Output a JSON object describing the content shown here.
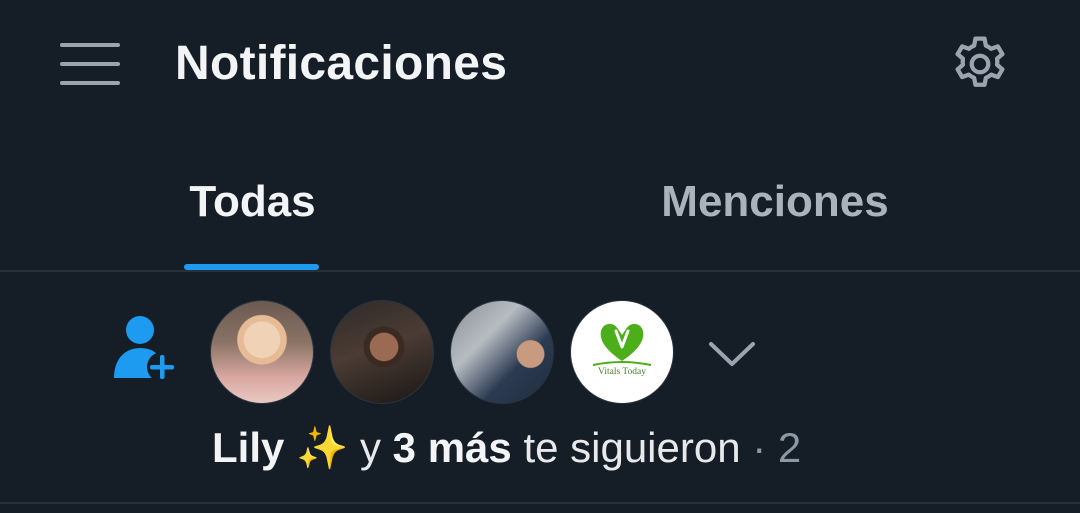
{
  "header": {
    "title": "Notificaciones",
    "menu_icon": "hamburger-menu-icon",
    "settings_icon": "gear-icon"
  },
  "tabs": [
    {
      "label": "Todas",
      "active": true
    },
    {
      "label": "Menciones",
      "active": false
    }
  ],
  "notification": {
    "type_icon": "person-add-icon",
    "avatars": [
      {
        "name": "avatar-lily"
      },
      {
        "name": "avatar-user-2"
      },
      {
        "name": "avatar-user-3"
      },
      {
        "name": "avatar-vitals-today",
        "logo_text": "Vitals Today"
      }
    ],
    "expand_icon": "chevron-down-icon",
    "actor": "Lily ✨",
    "connector": "y",
    "others": "3 más",
    "action": "te siguieron",
    "separator": "·",
    "time": "2"
  },
  "colors": {
    "background": "#151d27",
    "accent": "#1d9bf0",
    "text_primary": "#f2f4f5",
    "text_secondary": "#8b98a5",
    "vitals_green": "#4caf1a"
  }
}
